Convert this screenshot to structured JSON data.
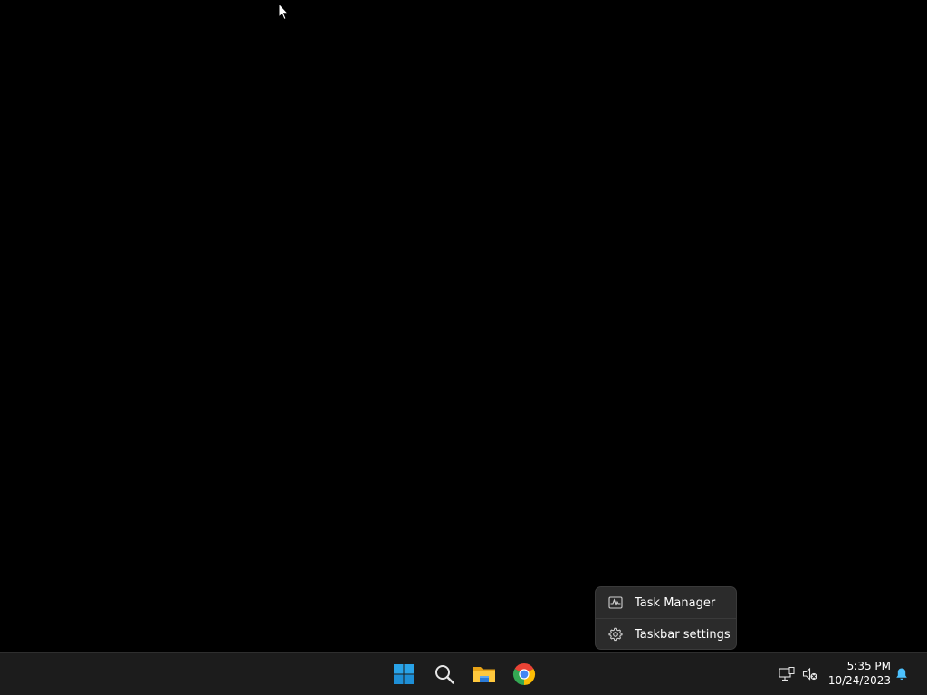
{
  "context_menu": {
    "items": [
      {
        "label": "Task Manager",
        "icon": "task-manager-icon"
      },
      {
        "label": "Taskbar settings",
        "icon": "gear-icon"
      }
    ]
  },
  "taskbar": {
    "pinned": [
      {
        "name": "Start",
        "icon": "windows-start-icon"
      },
      {
        "name": "Search",
        "icon": "search-icon"
      },
      {
        "name": "File Explorer",
        "icon": "folder-icon"
      },
      {
        "name": "Google Chrome",
        "icon": "chrome-icon"
      }
    ],
    "tray": {
      "network_icon": "network-icon",
      "volume_icon": "volume-muted-icon",
      "time": "5:35 PM",
      "date": "10/24/2023",
      "notification_icon": "bell-icon"
    }
  },
  "colors": {
    "desktop_background": "#000000",
    "taskbar_background": "#1c1c1c",
    "menu_background": "#2b2b2b",
    "start_blue": "#29a3e8",
    "notification_accent": "#4cc2ff"
  }
}
